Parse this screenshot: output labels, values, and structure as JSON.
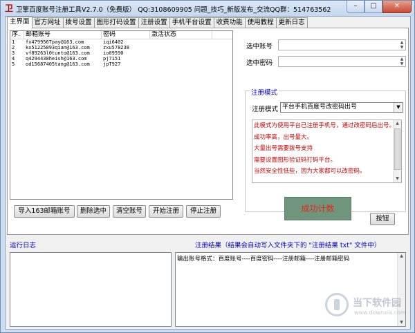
{
  "window": {
    "title": "卫擎百度账号注册工具V2.7.0（免费版）  QQ:3108609905  问题_技巧_新版发布_交流QQ群：514763562",
    "minimize_glyph": "–",
    "maximize_glyph": "□",
    "close_glyph": "✕"
  },
  "tabs": [
    {
      "label": "主界面",
      "active": true
    },
    {
      "label": "官方网址"
    },
    {
      "label": "拨号设置"
    },
    {
      "label": "图形打码设置"
    },
    {
      "label": "注册设置"
    },
    {
      "label": "手机平台设置"
    },
    {
      "label": "收费功能"
    },
    {
      "label": "使用教程"
    },
    {
      "label": "更新日志"
    }
  ],
  "account_list": {
    "columns": [
      "序.",
      "邮箱账号",
      "密码",
      "激活状态"
    ],
    "rows": [
      [
        "1",
        "fx479956Tpay@163.com",
        "iqi6402",
        ""
      ],
      [
        "2",
        "kx51225893qian@163.com",
        "zxu578238",
        ""
      ],
      [
        "3",
        "vf89263l0tunto@163.com",
        "io09590",
        ""
      ],
      [
        "4",
        "q4294438heish@163.com",
        "pj7151",
        ""
      ],
      [
        "5",
        "od15687405tang@163.com",
        "jpT927",
        ""
      ]
    ]
  },
  "form": {
    "selected_account_label": "选中账号",
    "selected_account_value": "",
    "selected_password_label": "选中密码",
    "selected_password_value": "",
    "spin_up": "▲",
    "spin_down": "▼"
  },
  "register_mode": {
    "group_title": "注册模式",
    "mode_label": "注册模式",
    "mode_value": "平台手机百度号改密码出号",
    "dropdown_glyph": "▼",
    "notes": [
      "此模式为使用平台已注册手机号，通过改密码后出号。",
      "成功率高，出号量大。",
      "大量出号需要拨号支持",
      "需要设置图形验证码打码平台。",
      "当然安全性低些，因为大家都可以改密码。"
    ]
  },
  "buttons": {
    "import": "导入163邮箱账号",
    "delete_selected": "删除选中",
    "clear_accounts": "清空账号",
    "start": "开始注册",
    "stop": "停止注册",
    "button": "按钮"
  },
  "success_count": "成功计数",
  "log": {
    "title": "运行日志"
  },
  "result": {
    "title": "注册结果（结果会自动写入文件夹下的 \"注册结果 txt\" 文件中）",
    "text": "输出账号格式：百度账号----百度密码----注册邮箱----注册邮箱密码"
  },
  "watermark": {
    "name": "当下软件园",
    "url": "www.downxia.com"
  }
}
